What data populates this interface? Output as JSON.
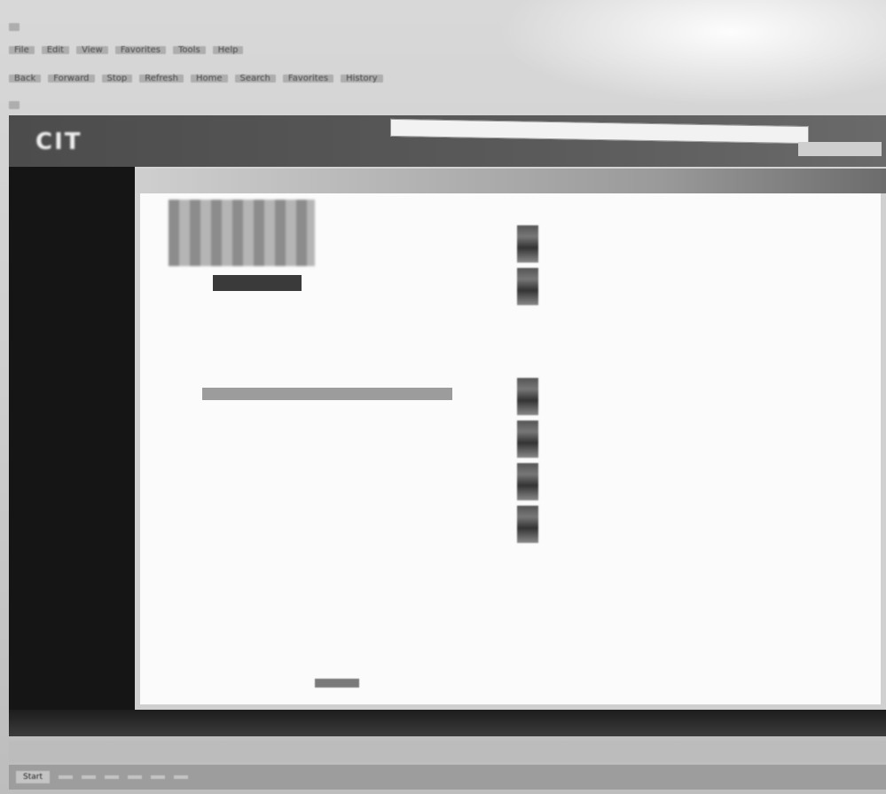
{
  "window": {
    "title_bar": "",
    "menu_items": [
      "File",
      "Edit",
      "View",
      "Favorites",
      "Tools",
      "Help"
    ],
    "toolbar_items": [
      "Back",
      "Forward",
      "Stop",
      "Refresh",
      "Home",
      "Search",
      "Favorites",
      "History"
    ],
    "address": ""
  },
  "site": {
    "logo": "CIT",
    "search_label": "",
    "breadcrumb": "",
    "top_right": ""
  },
  "sidebar": {
    "items": [
      "",
      "",
      "",
      "",
      "",
      "",
      "",
      "",
      "",
      "",
      "",
      "",
      "",
      "",
      "",
      "",
      "",
      "",
      ""
    ]
  },
  "main": {
    "promo_button": "",
    "form": {
      "field1_label": "",
      "field2_label": "",
      "field3_label": "",
      "field4_label": ""
    }
  },
  "right_column": {
    "sections": [
      {
        "title": "",
        "text": ""
      },
      {
        "title": "",
        "text": ""
      },
      {
        "title": "",
        "text": ""
      },
      {
        "title": "",
        "text": ""
      },
      {
        "title": "",
        "text": ""
      },
      {
        "title": "",
        "text": ""
      }
    ]
  },
  "pager": {
    "label": ""
  },
  "status_bar": {
    "text": ""
  },
  "taskbar": {
    "items": [
      "Start",
      "",
      "",
      "",
      "",
      "",
      ""
    ]
  }
}
